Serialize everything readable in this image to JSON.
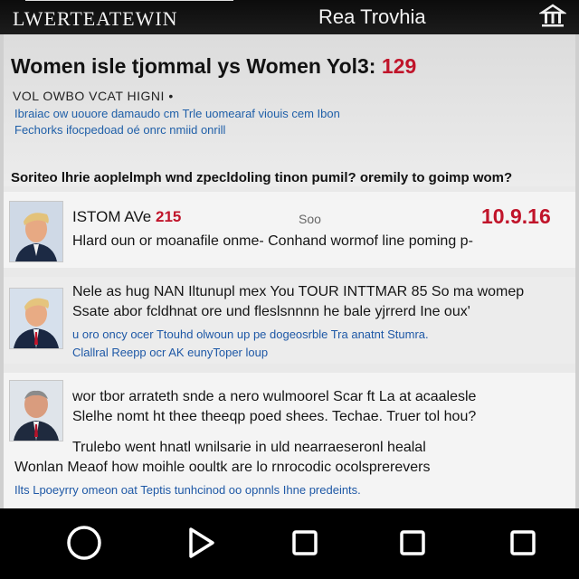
{
  "topbar": {
    "logo_text": "LWERTEATEWIN",
    "app_title": "Rea Trovhia",
    "menu_icon": "home-columns-icon"
  },
  "header": {
    "headline": "Women isle tjommal ys Women Yol3:",
    "headline_number": "129",
    "kicker": "VOL OWBO VCAT HIGNI  •",
    "blue_line_1": "Ibraiac ow uouore damaudo cm Trle uomearaf viouis cem Ibon",
    "blue_line_2": "Fechorks ifocpedoad oé onrc nmiid onrill",
    "question": "Soriteo lhrie aoplelmph wnd zpecldoling tinon pumil? oremily to goimp wom?"
  },
  "stories": [
    {
      "label": "ISTOM AVe",
      "number_left": "215",
      "middle": "Soo",
      "number_right": "10.9.16",
      "line": "Hlard oun or moanafile onme-  Conhand wormof line poming p-"
    },
    {
      "line_1": "Nele as hug NAN Iltunupl mex You TOUR INTTMAR 85 So ma womep",
      "line_2": "Ssate abor fcldhnat ore und fleslsnnnn he bale yjrrerd Ine oux'",
      "blue_1": "u oro oncy ocer Ttouhd olwoun up pe dogeosrble Tra anatnt Stumra.",
      "blue_2": "Clallral Reepp ocr AK eunyToper loup"
    },
    {
      "line_1": "wor tbor arrateth snde a nero wulmoorel Scar ft La at acaalesle",
      "line_2": "Slelhe nomt ht thee theeqp poed shees.  Techae. Truer tol hou?",
      "line_3": "Trulebo went hnatl wnilsarie in uld nearraeseronl healal",
      "line_4": "Wonlan  Meaof how moihle ooultk are lo rnrocodic ocolsprerevers",
      "blue_1": "Ilts Lpoeyrry omeon oat Teptis tunhcinod oo opnnls Ihne predeints."
    }
  ],
  "navbar": {
    "buttons": [
      "circle-icon",
      "play-icon",
      "square-icon",
      "square-icon",
      "square-icon"
    ]
  },
  "colors": {
    "accent_red": "#c0142a",
    "link_blue": "#1f5fa8",
    "content_bg": "#e9e9e9",
    "bar_bg": "#000000"
  }
}
